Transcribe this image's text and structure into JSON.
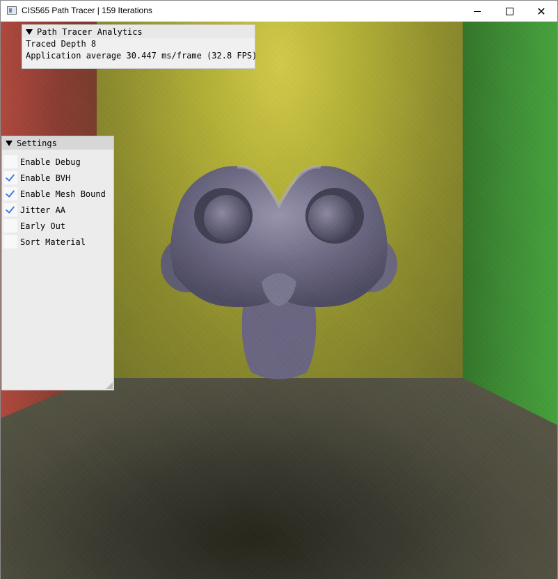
{
  "window": {
    "title": "CIS565 Path Tracer | 159 Iterations",
    "minimize_icon": "minimize-icon",
    "maximize_icon": "maximize-icon",
    "close_symbol": "✕"
  },
  "analytics": {
    "title": "Path Tracer Analytics",
    "traced_depth": "Traced Depth 8",
    "average": "Application average 30.447 ms/frame (32.8 FPS)"
  },
  "settings": {
    "title": "Settings",
    "items": [
      {
        "label": "Enable Debug",
        "checked": false
      },
      {
        "label": "Enable BVH",
        "checked": true
      },
      {
        "label": "Enable Mesh Bound",
        "checked": true
      },
      {
        "label": "Jitter AA",
        "checked": true
      },
      {
        "label": "Early Out",
        "checked": false
      },
      {
        "label": "Sort Material",
        "checked": false
      }
    ]
  },
  "colors": {
    "checkmark": "#3d7be0",
    "back_wall": "#b7b434",
    "left_wall": "#b5473b",
    "right_wall": "#45a63a"
  }
}
